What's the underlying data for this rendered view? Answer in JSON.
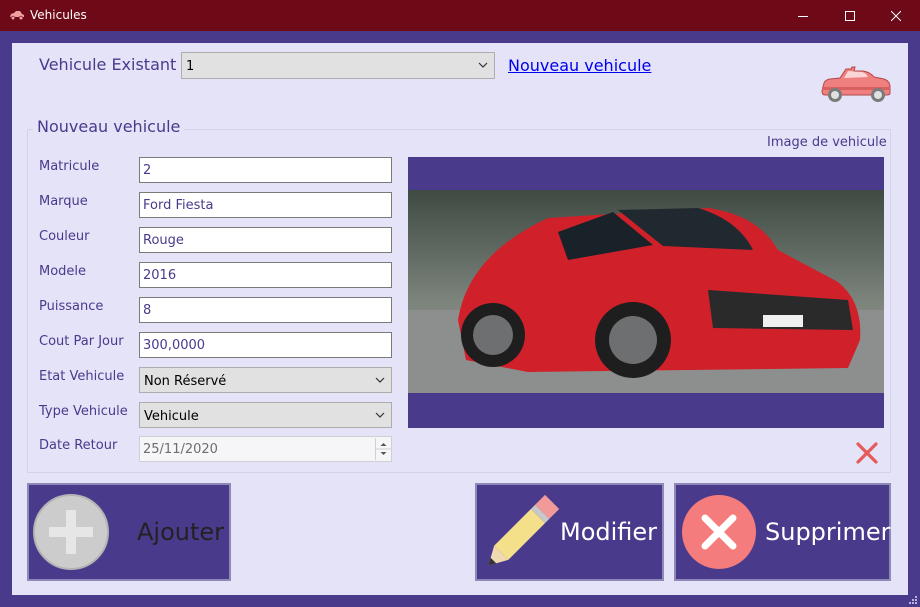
{
  "window": {
    "title": "Vehicules"
  },
  "header": {
    "existing_label": "Vehicule Existant",
    "existing_value": "1",
    "new_link": "Nouveau vehicule"
  },
  "group": {
    "title": "Nouveau vehicule",
    "image_label": "Image de vehicule",
    "fields": {
      "matricule": {
        "label": "Matricule",
        "value": "2"
      },
      "marque": {
        "label": "Marque",
        "value": "Ford Fiesta"
      },
      "couleur": {
        "label": "Couleur",
        "value": "Rouge"
      },
      "modele": {
        "label": "Modele",
        "value": "2016"
      },
      "puissance": {
        "label": "Puissance",
        "value": "8"
      },
      "cout": {
        "label": "Cout Par Jour",
        "value": "300,0000"
      },
      "etat": {
        "label": "Etat Vehicule",
        "value": "Non Réservé"
      },
      "type": {
        "label": "Type Vehicule",
        "value": "Vehicule"
      },
      "date_retour": {
        "label": "Date Retour",
        "value": "25/11/2020"
      }
    }
  },
  "buttons": {
    "ajouter": "Ajouter",
    "modifier": "Modifier",
    "supprimer": "Supprimer"
  },
  "colors": {
    "accent": "#4a3a8c",
    "titlebar": "#6e0a17",
    "client_bg": "#e4e3f8",
    "delete_red": "#e85a5a"
  },
  "icons": {
    "app": "car-icon",
    "header_car": "car-icon",
    "remove_image": "close-icon",
    "ajouter": "plus-circle-icon",
    "modifier": "pencil-icon",
    "supprimer": "x-circle-icon"
  }
}
